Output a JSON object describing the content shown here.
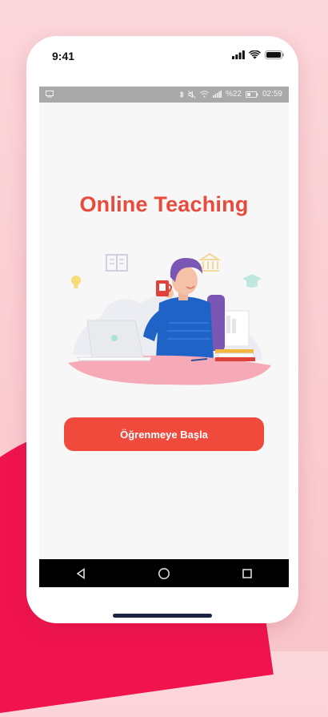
{
  "ios_status": {
    "time": "9:41"
  },
  "android_status": {
    "right_text": "%22",
    "time": "02:59"
  },
  "title": "Online Teaching",
  "start_button": {
    "label": "Öğrenmeye Başla"
  },
  "colors": {
    "accent": "#f04a3c",
    "title": "#e84a3c",
    "blob": "#f0134d"
  }
}
